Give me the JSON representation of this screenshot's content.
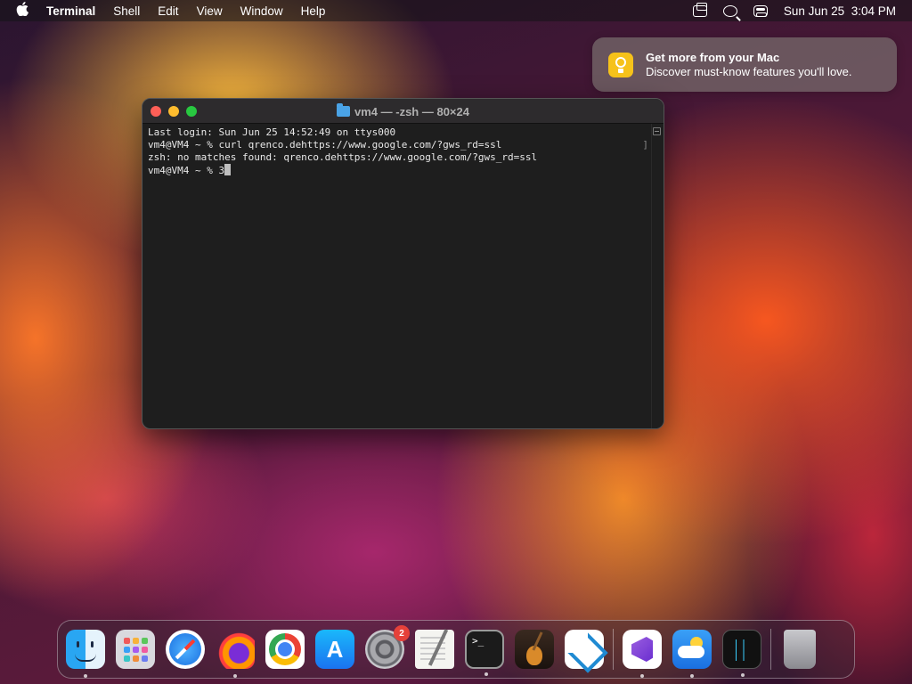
{
  "menubar": {
    "apple_icon": "apple-icon",
    "app_name": "Terminal",
    "menus": [
      "Shell",
      "Edit",
      "View",
      "Window",
      "Help"
    ],
    "date": "Sun Jun 25",
    "time": "3:04 PM"
  },
  "notification": {
    "icon": "lightbulb-icon",
    "title": "Get more from your Mac",
    "body": "Discover must-know features you'll love."
  },
  "terminal": {
    "title": "vm4 — -zsh — 80×24",
    "lines": [
      "Last login: Sun Jun 25 14:52:49 on ttys000",
      "vm4@VM4 ~ % curl qrenco.dehttps://www.google.com/?gws_rd=ssl",
      "zsh: no matches found: qrenco.dehttps://www.google.com/?gws_rd=ssl",
      "vm4@VM4 ~ % 3"
    ],
    "colors": {
      "background": "#1e1e1e",
      "text": "#e8e8e8"
    }
  },
  "dock": {
    "items": [
      {
        "name": "Finder",
        "icon": "finder-icon",
        "running": true
      },
      {
        "name": "Launchpad",
        "icon": "launchpad-icon",
        "running": false
      },
      {
        "name": "Safari",
        "icon": "safari-icon",
        "running": false
      },
      {
        "name": "Firefox",
        "icon": "firefox-icon",
        "running": true
      },
      {
        "name": "Google Chrome",
        "icon": "chrome-icon",
        "running": false
      },
      {
        "name": "App Store",
        "icon": "app-store-icon",
        "running": false
      },
      {
        "name": "System Settings",
        "icon": "settings-icon",
        "running": false,
        "badge": "2"
      },
      {
        "name": "TextEdit",
        "icon": "textedit-icon",
        "running": false
      },
      {
        "name": "Terminal",
        "icon": "terminal-icon",
        "running": true
      },
      {
        "name": "GarageBand",
        "icon": "garageband-icon",
        "running": false
      },
      {
        "name": "Visual Studio Code",
        "icon": "vscode-icon",
        "running": false
      }
    ],
    "recent": [
      {
        "name": "Visual Studio",
        "icon": "visual-studio-icon",
        "running": true
      },
      {
        "name": "Weather",
        "icon": "weather-icon",
        "running": true
      },
      {
        "name": "Activity Monitor",
        "icon": "activity-monitor-icon",
        "running": true
      }
    ],
    "trash": {
      "name": "Trash",
      "icon": "trash-icon"
    }
  }
}
